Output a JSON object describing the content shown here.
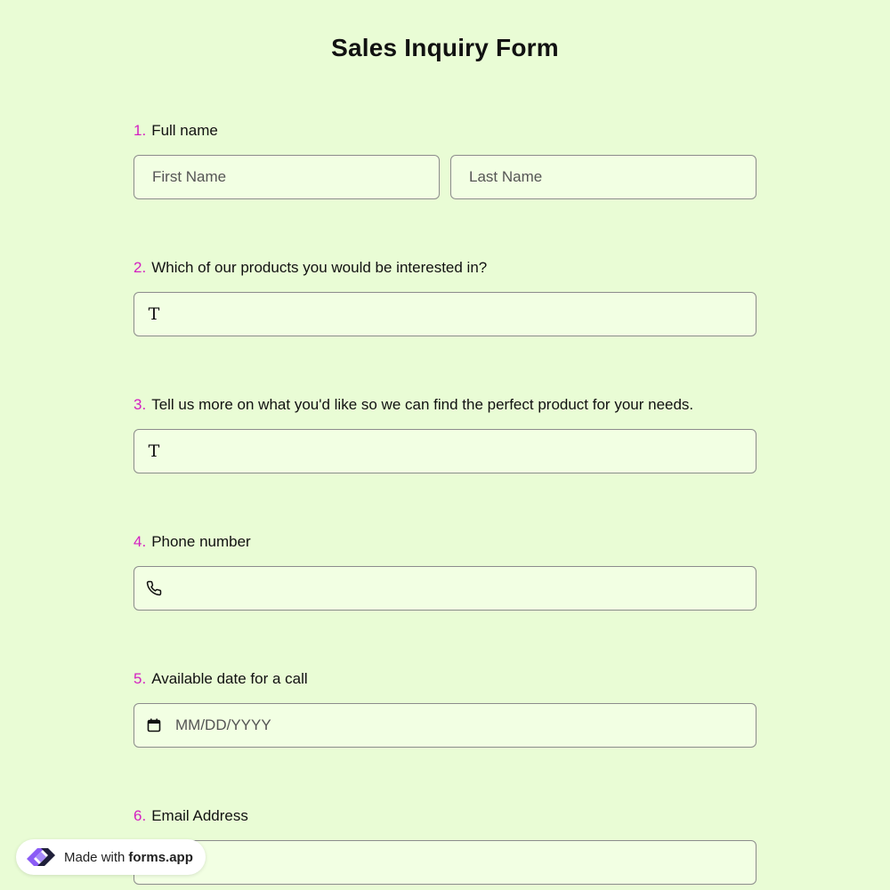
{
  "form": {
    "title": "Sales Inquiry Form"
  },
  "questions": [
    {
      "number": "1.",
      "label": "Full name",
      "first_name_placeholder": "First Name",
      "last_name_placeholder": "Last Name"
    },
    {
      "number": "2.",
      "label": "Which of our products you would be interested in?",
      "icon": "text-type-icon",
      "icon_glyph": "T"
    },
    {
      "number": "3.",
      "label": "Tell us more on what you'd like so we can find the perfect product for your needs.",
      "icon": "text-type-icon",
      "icon_glyph": "T"
    },
    {
      "number": "4.",
      "label": "Phone number",
      "icon": "phone-icon"
    },
    {
      "number": "5.",
      "label": "Available date for a call",
      "icon": "calendar-icon",
      "placeholder": "MM/DD/YYYY"
    },
    {
      "number": "6.",
      "label": "Email Address"
    }
  ],
  "badge": {
    "prefix": "Made with",
    "brand": "forms.app",
    "logo_icon": "forms-app-logo-icon"
  },
  "colors": {
    "background": "#e9fcd5",
    "field_background": "#f2ffe3",
    "accent_number": "#d41fc1",
    "logo_purple": "#8b5cf6",
    "logo_dark": "#1f1f3a"
  }
}
